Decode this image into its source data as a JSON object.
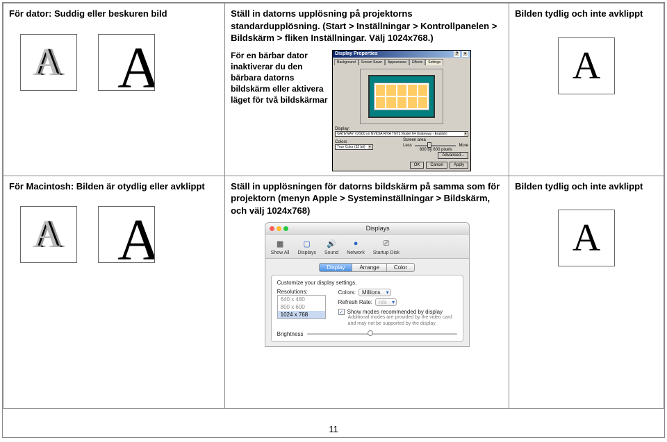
{
  "page_number": "11",
  "top": {
    "left_heading": "För dator: Suddig eller beskuren bild",
    "mid_heading": "Ställ in datorns upplösning på projektorns standardupplösning. (Start > Inställningar > Kontrollpanelen > Bildskärm > fliken Inställningar. Välj 1024x768.)",
    "mid_sub": "För en bärbar dator inaktiverar du den bärbara datorns bildskärm eller aktivera läget för två bildskärmar",
    "right_heading": "Bilden tydlig och inte avklippt"
  },
  "bottom": {
    "left_heading": "För Macintosh: Bilden är otydlig eller avklippt",
    "mid_heading": "Ställ in upplösningen för datorns bildskärm på samma som för projektorn (menyn Apple > Systeminställningar > Bildskärm, och välj 1024x768)",
    "right_heading": "Bilden tydlig och inte avklippt"
  },
  "win": {
    "title": "Display Properties",
    "tabs": [
      "Background",
      "Screen Saver",
      "Appearance",
      "Effects",
      "Settings"
    ],
    "display_label": "Display:",
    "display_value": "GATEWAY VX900 on NVIDIA RIVA TNT2 Model 64 (Gateway - English)",
    "colors_label": "Colors",
    "colors_value": "True Color (32 bit)",
    "area_label": "Screen area",
    "area_less": "Less",
    "area_more": "More",
    "area_value": "800 by 600 pixels",
    "advanced": "Advanced...",
    "ok": "OK",
    "cancel": "Cancel",
    "apply": "Apply"
  },
  "mac": {
    "title": "Displays",
    "toolbar": [
      "Show All",
      "Displays",
      "Sound",
      "Network",
      "Startup Disk"
    ],
    "segments": [
      "Display",
      "Arrange",
      "Color"
    ],
    "desc": "Customize your display settings.",
    "res_label": "Resolutions:",
    "res_items": [
      "640 x 480",
      "800 x 600",
      "1024 x 768"
    ],
    "colors_label": "Colors:",
    "colors_value": "Millions",
    "refresh_label": "Refresh Rate:",
    "refresh_value": "n/a",
    "cb_label": "Show modes recommended by display",
    "cb_note": "Additional modes are provided by the video card and may not be supported by the display.",
    "brightness": "Brightness"
  }
}
